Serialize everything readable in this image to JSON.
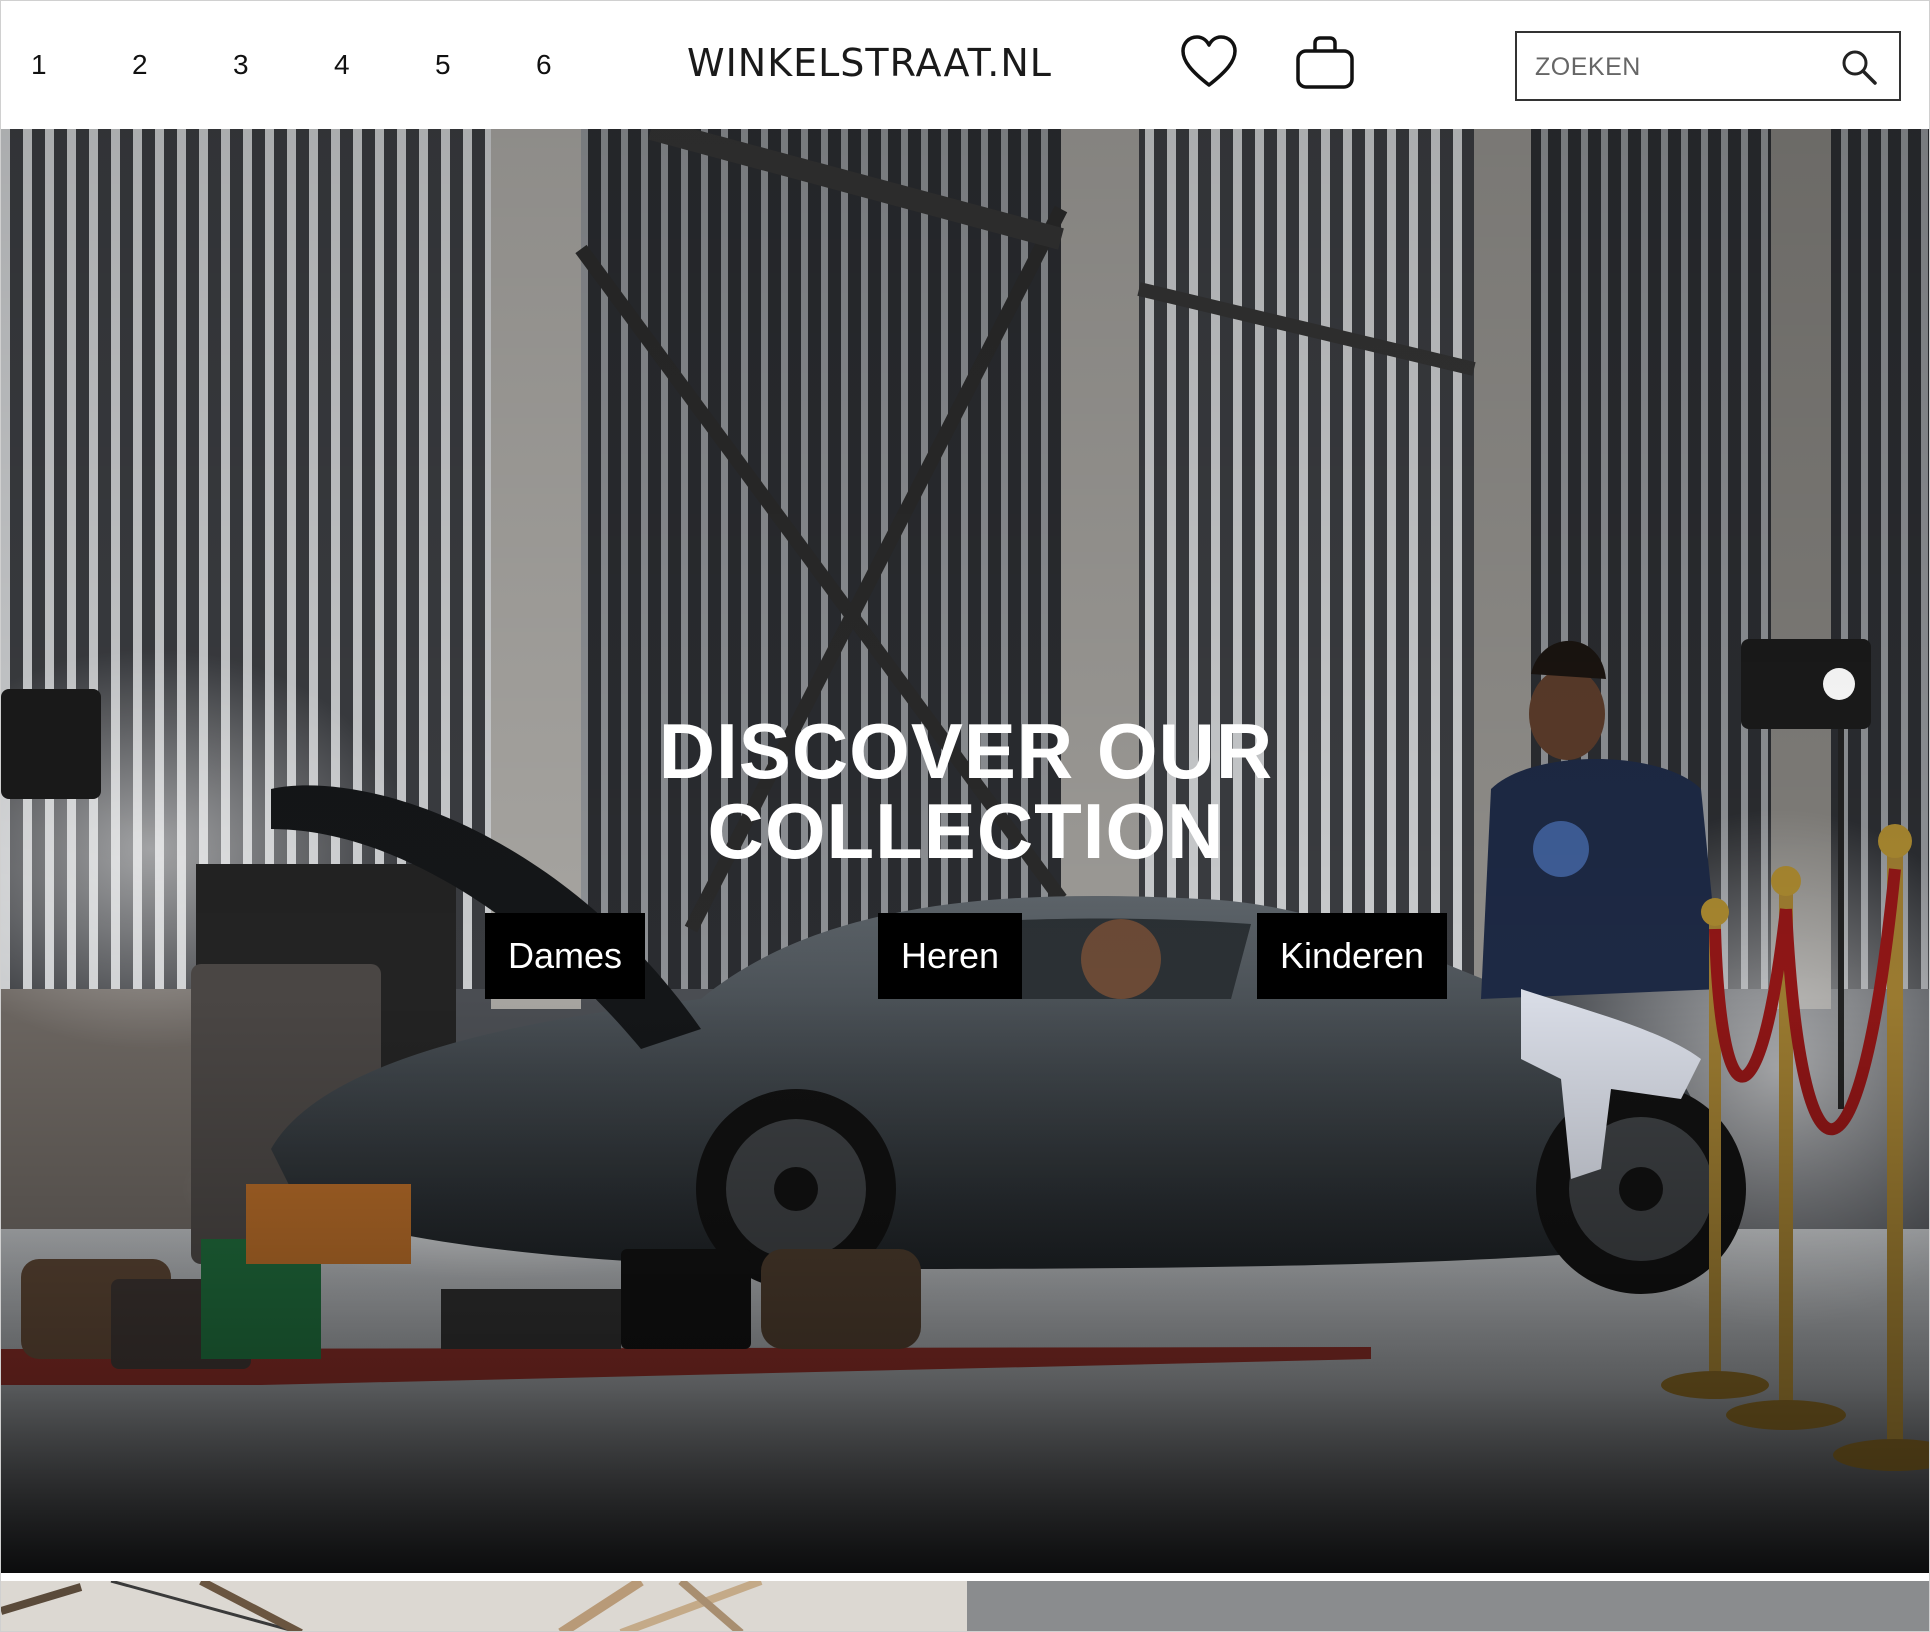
{
  "header": {
    "pagination": [
      "1",
      "2",
      "3",
      "4",
      "5",
      "6"
    ],
    "logo": "WINKELSTRAAT.NL",
    "wishlist_icon": "heart-icon",
    "cart_icon": "shopping-bag-icon",
    "search": {
      "placeholder": "ZOEKEN",
      "icon": "search-icon"
    }
  },
  "hero": {
    "title_line1": "DISCOVER OUR",
    "title_line2": "COLLECTION",
    "buttons": {
      "dames": "Dames",
      "heren": "Heren",
      "kinderen": "Kinderen"
    }
  },
  "colors": {
    "button_bg": "#000000",
    "button_text": "#ffffff",
    "header_bg": "#ffffff"
  }
}
